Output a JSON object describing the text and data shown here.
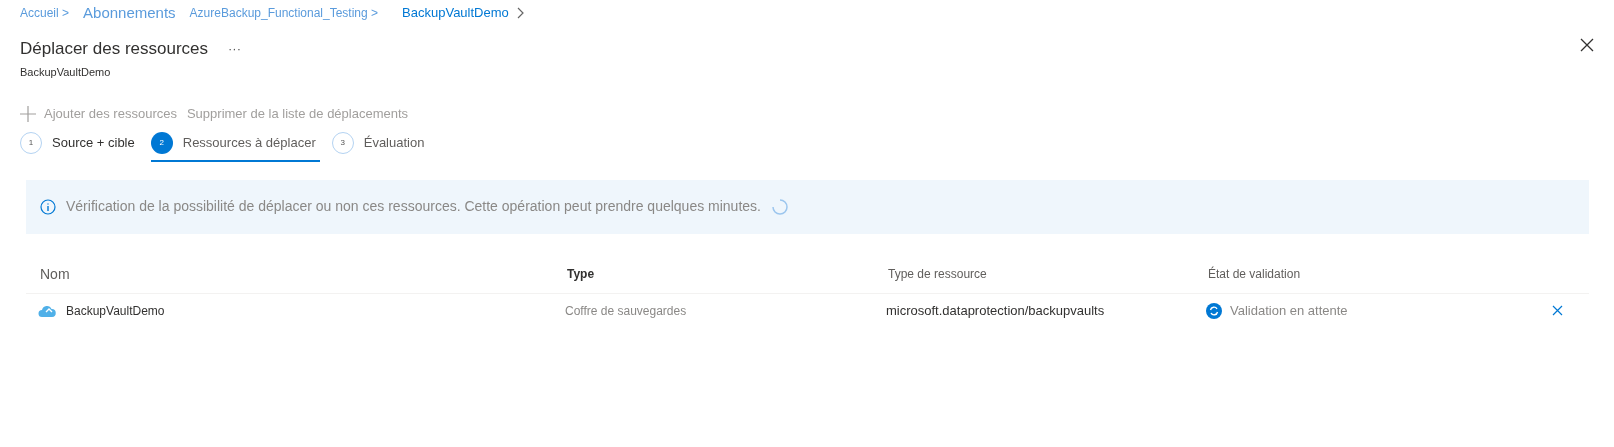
{
  "breadcrumb": [
    {
      "label": "Accueil >",
      "current": false
    },
    {
      "label": "Abonnements",
      "current": false
    },
    {
      "label": "AzureBackup_Functional_Testing >",
      "current": false
    },
    {
      "label": "BackupVaultDemo",
      "current": true
    }
  ],
  "title": "Déplacer des ressources",
  "more": "···",
  "subtitle": "BackupVaultDemo",
  "toolbar": [
    {
      "label": "Ajouter des ressources",
      "disabled": true,
      "kind": "add"
    },
    {
      "label": "Supprimer de la liste de déplacements",
      "disabled": true,
      "kind": "text"
    }
  ],
  "steps": [
    {
      "number": "1",
      "label": "Source + cible",
      "selected": false
    },
    {
      "number": "2",
      "label": "Ressources à déplacer",
      "selected": true
    },
    {
      "number": "3",
      "label": "Évaluation",
      "selected": false
    }
  ],
  "banner": {
    "text": "Vérification de la possibilité de déplacer ou non ces ressources. Cette opération peut prendre quelques minutes."
  },
  "table": {
    "columns": [
      "Nom",
      "Type",
      "Type de ressource",
      "État de validation"
    ],
    "rows": [
      {
        "name": "BackupVaultDemo",
        "type": "Coffre de sauvegardes",
        "resource_type": "microsoft.dataprotection/backupvaults",
        "status": "Validation en attente"
      }
    ]
  }
}
